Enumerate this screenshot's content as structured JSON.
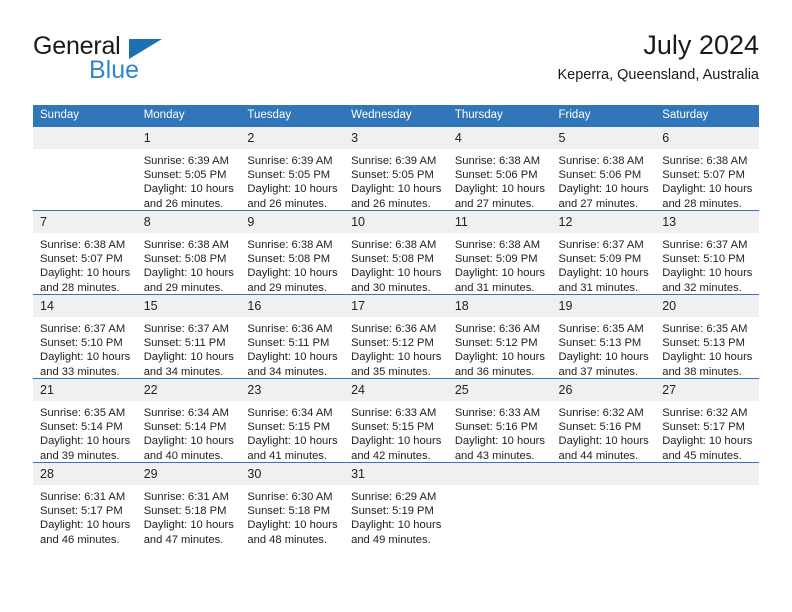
{
  "brand": {
    "name_top": "General",
    "name_bottom": "Blue",
    "triangle_color": "#1f6fb4",
    "blue_text_color": "#2f86d0"
  },
  "header": {
    "month_year": "July 2024",
    "location": "Keperra, Queensland, Australia"
  },
  "theme": {
    "header_blue": "#3176b8",
    "daynum_band": "#f0f0f0",
    "text": "#222222"
  },
  "weekdays": [
    "Sunday",
    "Monday",
    "Tuesday",
    "Wednesday",
    "Thursday",
    "Friday",
    "Saturday"
  ],
  "labels": {
    "sunrise_prefix": "Sunrise:",
    "sunset_prefix": "Sunset:",
    "daylight_prefix": "Daylight:"
  },
  "weeks": [
    [
      {
        "day": "",
        "sunrise": "",
        "sunset": "",
        "daylight_line1": "",
        "daylight_line2": ""
      },
      {
        "day": "1",
        "sunrise": "Sunrise: 6:39 AM",
        "sunset": "Sunset: 5:05 PM",
        "daylight_line1": "Daylight: 10 hours",
        "daylight_line2": "and 26 minutes."
      },
      {
        "day": "2",
        "sunrise": "Sunrise: 6:39 AM",
        "sunset": "Sunset: 5:05 PM",
        "daylight_line1": "Daylight: 10 hours",
        "daylight_line2": "and 26 minutes."
      },
      {
        "day": "3",
        "sunrise": "Sunrise: 6:39 AM",
        "sunset": "Sunset: 5:05 PM",
        "daylight_line1": "Daylight: 10 hours",
        "daylight_line2": "and 26 minutes."
      },
      {
        "day": "4",
        "sunrise": "Sunrise: 6:38 AM",
        "sunset": "Sunset: 5:06 PM",
        "daylight_line1": "Daylight: 10 hours",
        "daylight_line2": "and 27 minutes."
      },
      {
        "day": "5",
        "sunrise": "Sunrise: 6:38 AM",
        "sunset": "Sunset: 5:06 PM",
        "daylight_line1": "Daylight: 10 hours",
        "daylight_line2": "and 27 minutes."
      },
      {
        "day": "6",
        "sunrise": "Sunrise: 6:38 AM",
        "sunset": "Sunset: 5:07 PM",
        "daylight_line1": "Daylight: 10 hours",
        "daylight_line2": "and 28 minutes."
      }
    ],
    [
      {
        "day": "7",
        "sunrise": "Sunrise: 6:38 AM",
        "sunset": "Sunset: 5:07 PM",
        "daylight_line1": "Daylight: 10 hours",
        "daylight_line2": "and 28 minutes."
      },
      {
        "day": "8",
        "sunrise": "Sunrise: 6:38 AM",
        "sunset": "Sunset: 5:08 PM",
        "daylight_line1": "Daylight: 10 hours",
        "daylight_line2": "and 29 minutes."
      },
      {
        "day": "9",
        "sunrise": "Sunrise: 6:38 AM",
        "sunset": "Sunset: 5:08 PM",
        "daylight_line1": "Daylight: 10 hours",
        "daylight_line2": "and 29 minutes."
      },
      {
        "day": "10",
        "sunrise": "Sunrise: 6:38 AM",
        "sunset": "Sunset: 5:08 PM",
        "daylight_line1": "Daylight: 10 hours",
        "daylight_line2": "and 30 minutes."
      },
      {
        "day": "11",
        "sunrise": "Sunrise: 6:38 AM",
        "sunset": "Sunset: 5:09 PM",
        "daylight_line1": "Daylight: 10 hours",
        "daylight_line2": "and 31 minutes."
      },
      {
        "day": "12",
        "sunrise": "Sunrise: 6:37 AM",
        "sunset": "Sunset: 5:09 PM",
        "daylight_line1": "Daylight: 10 hours",
        "daylight_line2": "and 31 minutes."
      },
      {
        "day": "13",
        "sunrise": "Sunrise: 6:37 AM",
        "sunset": "Sunset: 5:10 PM",
        "daylight_line1": "Daylight: 10 hours",
        "daylight_line2": "and 32 minutes."
      }
    ],
    [
      {
        "day": "14",
        "sunrise": "Sunrise: 6:37 AM",
        "sunset": "Sunset: 5:10 PM",
        "daylight_line1": "Daylight: 10 hours",
        "daylight_line2": "and 33 minutes."
      },
      {
        "day": "15",
        "sunrise": "Sunrise: 6:37 AM",
        "sunset": "Sunset: 5:11 PM",
        "daylight_line1": "Daylight: 10 hours",
        "daylight_line2": "and 34 minutes."
      },
      {
        "day": "16",
        "sunrise": "Sunrise: 6:36 AM",
        "sunset": "Sunset: 5:11 PM",
        "daylight_line1": "Daylight: 10 hours",
        "daylight_line2": "and 34 minutes."
      },
      {
        "day": "17",
        "sunrise": "Sunrise: 6:36 AM",
        "sunset": "Sunset: 5:12 PM",
        "daylight_line1": "Daylight: 10 hours",
        "daylight_line2": "and 35 minutes."
      },
      {
        "day": "18",
        "sunrise": "Sunrise: 6:36 AM",
        "sunset": "Sunset: 5:12 PM",
        "daylight_line1": "Daylight: 10 hours",
        "daylight_line2": "and 36 minutes."
      },
      {
        "day": "19",
        "sunrise": "Sunrise: 6:35 AM",
        "sunset": "Sunset: 5:13 PM",
        "daylight_line1": "Daylight: 10 hours",
        "daylight_line2": "and 37 minutes."
      },
      {
        "day": "20",
        "sunrise": "Sunrise: 6:35 AM",
        "sunset": "Sunset: 5:13 PM",
        "daylight_line1": "Daylight: 10 hours",
        "daylight_line2": "and 38 minutes."
      }
    ],
    [
      {
        "day": "21",
        "sunrise": "Sunrise: 6:35 AM",
        "sunset": "Sunset: 5:14 PM",
        "daylight_line1": "Daylight: 10 hours",
        "daylight_line2": "and 39 minutes."
      },
      {
        "day": "22",
        "sunrise": "Sunrise: 6:34 AM",
        "sunset": "Sunset: 5:14 PM",
        "daylight_line1": "Daylight: 10 hours",
        "daylight_line2": "and 40 minutes."
      },
      {
        "day": "23",
        "sunrise": "Sunrise: 6:34 AM",
        "sunset": "Sunset: 5:15 PM",
        "daylight_line1": "Daylight: 10 hours",
        "daylight_line2": "and 41 minutes."
      },
      {
        "day": "24",
        "sunrise": "Sunrise: 6:33 AM",
        "sunset": "Sunset: 5:15 PM",
        "daylight_line1": "Daylight: 10 hours",
        "daylight_line2": "and 42 minutes."
      },
      {
        "day": "25",
        "sunrise": "Sunrise: 6:33 AM",
        "sunset": "Sunset: 5:16 PM",
        "daylight_line1": "Daylight: 10 hours",
        "daylight_line2": "and 43 minutes."
      },
      {
        "day": "26",
        "sunrise": "Sunrise: 6:32 AM",
        "sunset": "Sunset: 5:16 PM",
        "daylight_line1": "Daylight: 10 hours",
        "daylight_line2": "and 44 minutes."
      },
      {
        "day": "27",
        "sunrise": "Sunrise: 6:32 AM",
        "sunset": "Sunset: 5:17 PM",
        "daylight_line1": "Daylight: 10 hours",
        "daylight_line2": "and 45 minutes."
      }
    ],
    [
      {
        "day": "28",
        "sunrise": "Sunrise: 6:31 AM",
        "sunset": "Sunset: 5:17 PM",
        "daylight_line1": "Daylight: 10 hours",
        "daylight_line2": "and 46 minutes."
      },
      {
        "day": "29",
        "sunrise": "Sunrise: 6:31 AM",
        "sunset": "Sunset: 5:18 PM",
        "daylight_line1": "Daylight: 10 hours",
        "daylight_line2": "and 47 minutes."
      },
      {
        "day": "30",
        "sunrise": "Sunrise: 6:30 AM",
        "sunset": "Sunset: 5:18 PM",
        "daylight_line1": "Daylight: 10 hours",
        "daylight_line2": "and 48 minutes."
      },
      {
        "day": "31",
        "sunrise": "Sunrise: 6:29 AM",
        "sunset": "Sunset: 5:19 PM",
        "daylight_line1": "Daylight: 10 hours",
        "daylight_line2": "and 49 minutes."
      },
      {
        "day": "",
        "sunrise": "",
        "sunset": "",
        "daylight_line1": "",
        "daylight_line2": ""
      },
      {
        "day": "",
        "sunrise": "",
        "sunset": "",
        "daylight_line1": "",
        "daylight_line2": ""
      },
      {
        "day": "",
        "sunrise": "",
        "sunset": "",
        "daylight_line1": "",
        "daylight_line2": ""
      }
    ]
  ]
}
